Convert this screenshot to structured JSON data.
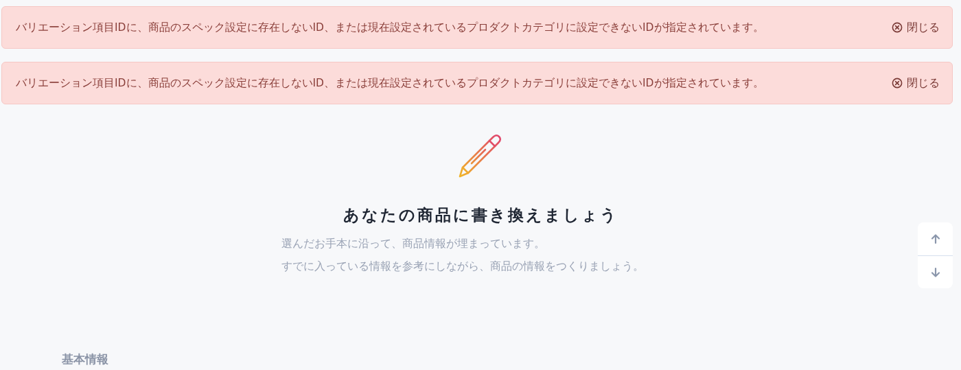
{
  "alerts": [
    {
      "message": "バリエーション項目IDに、商品のスペック設定に存在しないID、または現在設定されているプロダクトカテゴリに設定できないIDが指定されています。",
      "close_label": "閉じる"
    },
    {
      "message": "バリエーション項目IDに、商品のスペック設定に存在しないID、または現在設定されているプロダクトカテゴリに設定できないIDが指定されています。",
      "close_label": "閉じる"
    }
  ],
  "intro": {
    "title": "あなたの商品に書き換えましょう",
    "lines": [
      "選んだお手本に沿って、商品情報が埋まっています。",
      "すでに入っている情報を参考にしながら、商品の情報をつくりましょう。"
    ]
  },
  "section": {
    "title": "基本情報"
  }
}
